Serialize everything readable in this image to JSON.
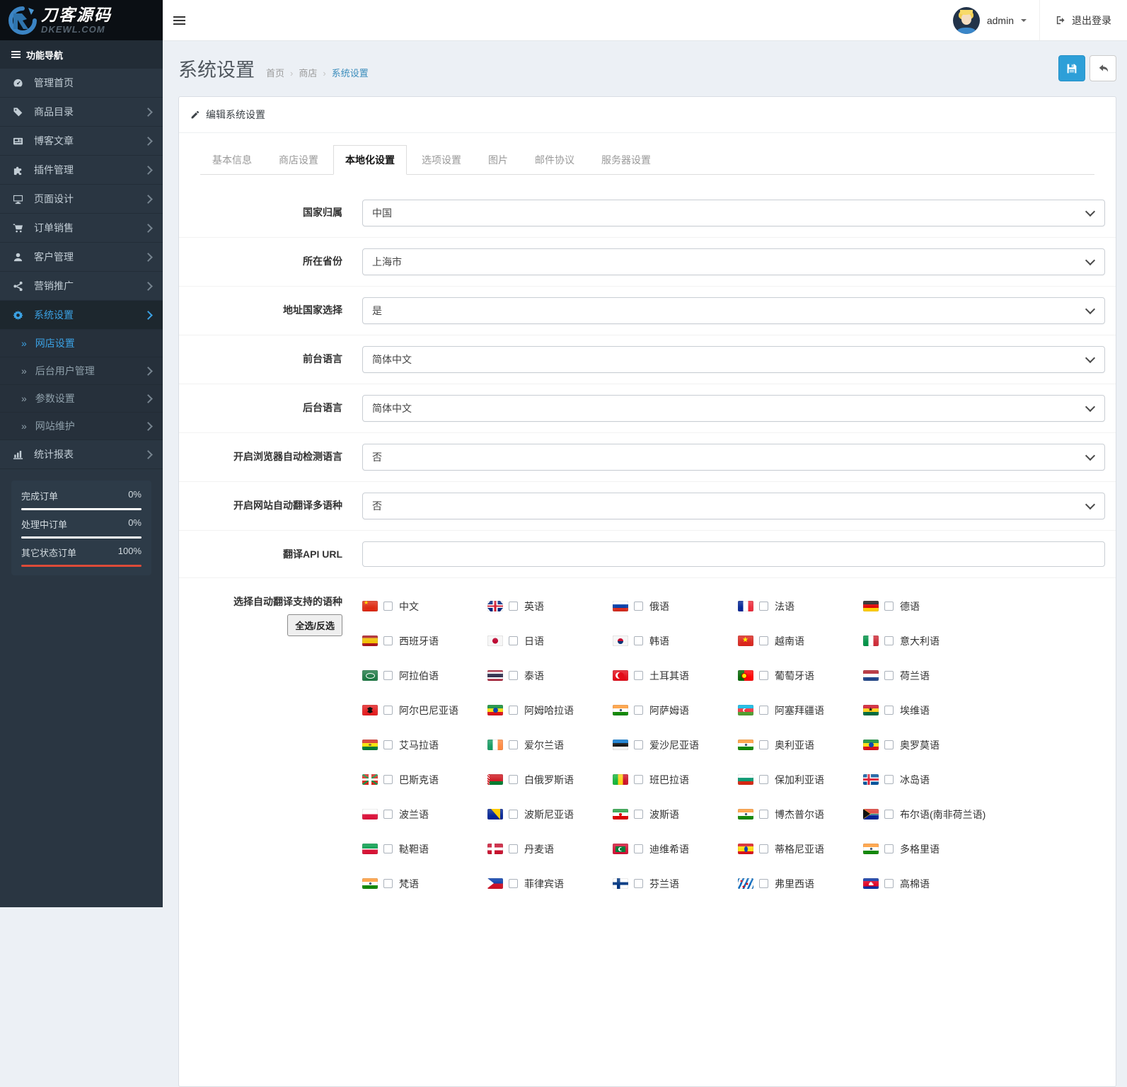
{
  "header": {
    "brand_name": "刀客源码",
    "brand_domain": "DKEWL.COM",
    "user_name": "admin",
    "logout_label": "退出登录"
  },
  "sidebar": {
    "nav_header": "功能导航",
    "items": [
      {
        "id": "home",
        "label": "管理首页",
        "icon": "dashboard-icon",
        "icon_key": "dashboard",
        "arrow": false,
        "active": false
      },
      {
        "id": "catalog",
        "label": "商品目录",
        "icon": "tags-icon",
        "icon_key": "tags",
        "arrow": true,
        "active": false
      },
      {
        "id": "blog",
        "label": "博客文章",
        "icon": "newspaper-icon",
        "icon_key": "news",
        "arrow": true,
        "active": false
      },
      {
        "id": "plugins",
        "label": "插件管理",
        "icon": "puzzle-icon",
        "icon_key": "puzzle",
        "arrow": true,
        "active": false
      },
      {
        "id": "design",
        "label": "页面设计",
        "icon": "desktop-icon",
        "icon_key": "desktop",
        "arrow": true,
        "active": false
      },
      {
        "id": "orders",
        "label": "订单销售",
        "icon": "cart-icon",
        "icon_key": "cart",
        "arrow": true,
        "active": false
      },
      {
        "id": "customers",
        "label": "客户管理",
        "icon": "user-icon",
        "icon_key": "user",
        "arrow": true,
        "active": false
      },
      {
        "id": "marketing",
        "label": "营销推广",
        "icon": "share-icon",
        "icon_key": "share",
        "arrow": true,
        "active": false
      },
      {
        "id": "settings",
        "label": "系统设置",
        "icon": "gear-icon",
        "icon_key": "gear",
        "arrow": true,
        "active": true
      }
    ],
    "subitems": [
      {
        "id": "store-settings",
        "label": "网店设置",
        "arrow": false,
        "active": true
      },
      {
        "id": "admin-users",
        "label": "后台用户管理",
        "arrow": true,
        "active": false
      },
      {
        "id": "parameters",
        "label": "参数设置",
        "arrow": true,
        "active": false
      },
      {
        "id": "maintenance",
        "label": "网站维护",
        "arrow": true,
        "active": false
      }
    ],
    "report_item": {
      "id": "reports",
      "label": "统计报表",
      "icon": "chart-bar-icon",
      "icon_key": "chart",
      "arrow": true
    },
    "order_stats": [
      {
        "label": "完成订单",
        "value": "0%",
        "color": "#ffffff"
      },
      {
        "label": "处理中订单",
        "value": "0%",
        "color": "#ffffff"
      },
      {
        "label": "其它状态订单",
        "value": "100%",
        "color": "#dd4b39"
      }
    ]
  },
  "page": {
    "title": "系统设置",
    "breadcrumb": [
      {
        "label": "首页",
        "active": false
      },
      {
        "label": "商店",
        "active": false
      },
      {
        "label": "系统设置",
        "active": true
      }
    ]
  },
  "panel": {
    "title": "编辑系统设置",
    "tabs": [
      {
        "id": "basic",
        "label": "基本信息",
        "active": false
      },
      {
        "id": "store",
        "label": "商店设置",
        "active": false
      },
      {
        "id": "localization",
        "label": "本地化设置",
        "active": true
      },
      {
        "id": "options",
        "label": "选项设置",
        "active": false
      },
      {
        "id": "image",
        "label": "图片",
        "active": false
      },
      {
        "id": "mail",
        "label": "邮件协议",
        "active": false
      },
      {
        "id": "server",
        "label": "服务器设置",
        "active": false
      }
    ],
    "fields": [
      {
        "id": "country",
        "label": "国家归属",
        "type": "select",
        "value": "中国"
      },
      {
        "id": "province",
        "label": "所在省份",
        "type": "select",
        "value": "上海市"
      },
      {
        "id": "address-country",
        "label": "地址国家选择",
        "type": "select",
        "value": "是"
      },
      {
        "id": "frontend-language",
        "label": "前台语言",
        "type": "select",
        "value": "简体中文"
      },
      {
        "id": "backend-language",
        "label": "后台语言",
        "type": "select",
        "value": "简体中文"
      },
      {
        "id": "browser-detect-language",
        "label": "开启浏览器自动检测语言",
        "type": "select",
        "value": "否"
      },
      {
        "id": "auto-translate",
        "label": "开启网站自动翻译多语种",
        "type": "select",
        "value": "否"
      },
      {
        "id": "translate-api-url",
        "label": "翻译API URL",
        "type": "text",
        "value": ""
      }
    ],
    "languages_field": {
      "label": "选择自动翻译支持的语种",
      "toggle_button": "全选/反选",
      "languages": [
        {
          "name": "中文",
          "flag": "cn"
        },
        {
          "name": "英语",
          "flag": "gb"
        },
        {
          "name": "俄语",
          "flag": "ru"
        },
        {
          "name": "法语",
          "flag": "fr"
        },
        {
          "name": "德语",
          "flag": "de"
        },
        {
          "name": "西班牙语",
          "flag": "es"
        },
        {
          "name": "日语",
          "flag": "jp"
        },
        {
          "name": "韩语",
          "flag": "kr"
        },
        {
          "name": "越南语",
          "flag": "vn"
        },
        {
          "name": "意大利语",
          "flag": "it"
        },
        {
          "name": "阿拉伯语",
          "flag": "sa"
        },
        {
          "name": "泰语",
          "flag": "th"
        },
        {
          "name": "土耳其语",
          "flag": "tr"
        },
        {
          "name": "葡萄牙语",
          "flag": "pt"
        },
        {
          "name": "荷兰语",
          "flag": "nl"
        },
        {
          "name": "阿尔巴尼亚语",
          "flag": "al"
        },
        {
          "name": "阿姆哈拉语",
          "flag": "et"
        },
        {
          "name": "阿萨姆语",
          "flag": "in"
        },
        {
          "name": "阿塞拜疆语",
          "flag": "az"
        },
        {
          "name": "埃维语",
          "flag": "gh"
        },
        {
          "name": "艾马拉语",
          "flag": "bo"
        },
        {
          "name": "爱尔兰语",
          "flag": "ie"
        },
        {
          "name": "爱沙尼亚语",
          "flag": "ee"
        },
        {
          "name": "奥利亚语",
          "flag": "in"
        },
        {
          "name": "奥罗莫语",
          "flag": "et"
        },
        {
          "name": "巴斯克语",
          "flag": "eus"
        },
        {
          "name": "白俄罗斯语",
          "flag": "by"
        },
        {
          "name": "班巴拉语",
          "flag": "ml"
        },
        {
          "name": "保加利亚语",
          "flag": "bg"
        },
        {
          "name": "冰岛语",
          "flag": "is"
        },
        {
          "name": "波兰语",
          "flag": "pl"
        },
        {
          "name": "波斯尼亚语",
          "flag": "ba"
        },
        {
          "name": "波斯语",
          "flag": "ir"
        },
        {
          "name": "博杰普尔语",
          "flag": "in"
        },
        {
          "name": "布尔语(南非荷兰语)",
          "flag": "za"
        },
        {
          "name": "鞑靼语",
          "flag": "tt"
        },
        {
          "name": "丹麦语",
          "flag": "dk"
        },
        {
          "name": "迪维希语",
          "flag": "mv"
        },
        {
          "name": "蒂格尼亚语",
          "flag": "er"
        },
        {
          "name": "多格里语",
          "flag": "in"
        },
        {
          "name": "梵语",
          "flag": "in"
        },
        {
          "name": "菲律宾语",
          "flag": "ph"
        },
        {
          "name": "芬兰语",
          "flag": "fi"
        },
        {
          "name": "弗里西语",
          "flag": "fy"
        },
        {
          "name": "高棉语",
          "flag": "kh"
        }
      ]
    }
  },
  "colors": {
    "accent": "#2d9fd8",
    "link": "#3c8dbc",
    "active_nav": "#3ba1e3",
    "danger": "#dd4b39",
    "sidebar_bg": "#2a3642"
  }
}
